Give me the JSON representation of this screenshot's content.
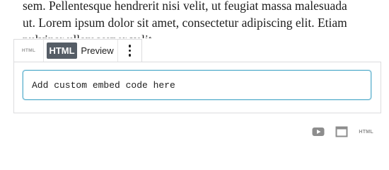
{
  "paragraph": {
    "line1": "sem. Pellentesque hendrerit nisi velit, ut feugiat massa malesuada",
    "line2": "ut. Lorem ipsum dolor sit amet, consectetur adipiscing elit. Etiam",
    "line3": "pulvinar ullamcorper velit."
  },
  "toolbar": {
    "block_icon_label": "HTML",
    "html_tab_label": "HTML",
    "preview_tab_label": "Preview"
  },
  "embed": {
    "placeholder": "Add custom embed code here",
    "value": ""
  },
  "inserter": {
    "icons": [
      "youtube-icon",
      "window-icon",
      "html-icon"
    ],
    "html_label": "HTML"
  },
  "colors": {
    "active_tab_bg": "#555d66",
    "focus_border": "#5fb2cf",
    "border": "#dcdcde",
    "icon_gray": "#8d8d8d"
  }
}
